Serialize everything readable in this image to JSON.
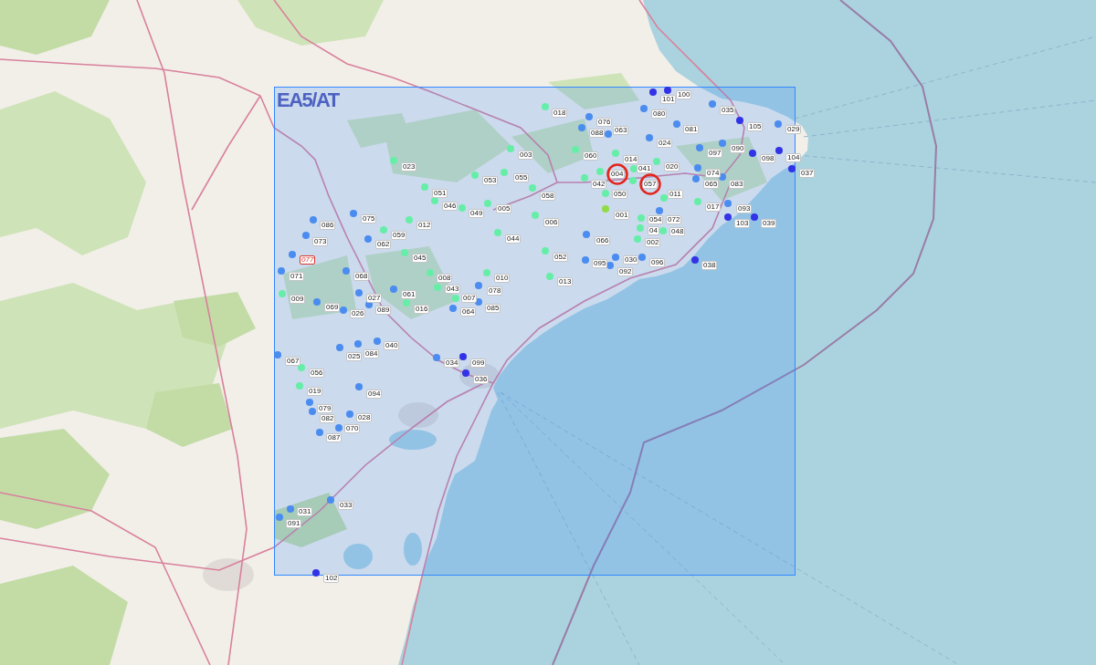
{
  "map": {
    "area_label": "EA5/AT",
    "stations": [
      {
        "label": "101",
        "color": "#3232e6",
        "selected": false,
        "flagged": false
      },
      {
        "label": "100",
        "color": "#3232e6",
        "selected": false,
        "flagged": false
      },
      {
        "label": "018",
        "color": "#66eea8",
        "selected": false,
        "flagged": false
      },
      {
        "label": "080",
        "color": "#4a8cf0",
        "selected": false,
        "flagged": false
      },
      {
        "label": "035",
        "color": "#4a8cf0",
        "selected": false,
        "flagged": false
      },
      {
        "label": "076",
        "color": "#4a8cf0",
        "selected": false,
        "flagged": false
      },
      {
        "label": "105",
        "color": "#3232e6",
        "selected": false,
        "flagged": false
      },
      {
        "label": "088",
        "color": "#4a8cf0",
        "selected": false,
        "flagged": false
      },
      {
        "label": "063",
        "color": "#4a8cf0",
        "selected": false,
        "flagged": false
      },
      {
        "label": "081",
        "color": "#4a8cf0",
        "selected": false,
        "flagged": false
      },
      {
        "label": "029",
        "color": "#4a8cf0",
        "selected": false,
        "flagged": false
      },
      {
        "label": "024",
        "color": "#4a8cf0",
        "selected": false,
        "flagged": false
      },
      {
        "label": "097",
        "color": "#4a8cf0",
        "selected": false,
        "flagged": false
      },
      {
        "label": "090",
        "color": "#4a8cf0",
        "selected": false,
        "flagged": false
      },
      {
        "label": "003",
        "color": "#66eea8",
        "selected": false,
        "flagged": false
      },
      {
        "label": "060",
        "color": "#66eea8",
        "selected": false,
        "flagged": false
      },
      {
        "label": "014",
        "color": "#66eea8",
        "selected": false,
        "flagged": false
      },
      {
        "label": "098",
        "color": "#3232e6",
        "selected": false,
        "flagged": false
      },
      {
        "label": "104",
        "color": "#3232e6",
        "selected": false,
        "flagged": false
      },
      {
        "label": "023",
        "color": "#66eea8",
        "selected": false,
        "flagged": false
      },
      {
        "label": "041",
        "color": "#66eea8",
        "selected": false,
        "flagged": false
      },
      {
        "label": "020",
        "color": "#66eea8",
        "selected": false,
        "flagged": false
      },
      {
        "label": "055",
        "color": "#66eea8",
        "selected": false,
        "flagged": false
      },
      {
        "label": "004",
        "color": "#66eea8",
        "selected": true,
        "flagged": false
      },
      {
        "label": "074",
        "color": "#4a8cf0",
        "selected": false,
        "flagged": false
      },
      {
        "label": "037",
        "color": "#3232e6",
        "selected": false,
        "flagged": false
      },
      {
        "label": "053",
        "color": "#66eea8",
        "selected": false,
        "flagged": false
      },
      {
        "label": "042",
        "color": "#66eea8",
        "selected": false,
        "flagged": false
      },
      {
        "label": "057",
        "color": "#66eea8",
        "selected": true,
        "flagged": false
      },
      {
        "label": "065",
        "color": "#4a8cf0",
        "selected": false,
        "flagged": false
      },
      {
        "label": "083",
        "color": "#4a8cf0",
        "selected": false,
        "flagged": false
      },
      {
        "label": "051",
        "color": "#66eea8",
        "selected": false,
        "flagged": false
      },
      {
        "label": "058",
        "color": "#66eea8",
        "selected": false,
        "flagged": false
      },
      {
        "label": "050",
        "color": "#66eea8",
        "selected": false,
        "flagged": false
      },
      {
        "label": "011",
        "color": "#66eea8",
        "selected": false,
        "flagged": false
      },
      {
        "label": "046",
        "color": "#66eea8",
        "selected": false,
        "flagged": false
      },
      {
        "label": "049",
        "color": "#66eea8",
        "selected": false,
        "flagged": false
      },
      {
        "label": "005",
        "color": "#66eea8",
        "selected": false,
        "flagged": false
      },
      {
        "label": "001",
        "color": "#8fdc48",
        "selected": false,
        "flagged": false
      },
      {
        "label": "017",
        "color": "#66eea8",
        "selected": false,
        "flagged": false
      },
      {
        "label": "093",
        "color": "#4a8cf0",
        "selected": false,
        "flagged": false
      },
      {
        "label": "086",
        "color": "#4a8cf0",
        "selected": false,
        "flagged": false
      },
      {
        "label": "075",
        "color": "#4a8cf0",
        "selected": false,
        "flagged": false
      },
      {
        "label": "012",
        "color": "#66eea8",
        "selected": false,
        "flagged": false
      },
      {
        "label": "006",
        "color": "#66eea8",
        "selected": false,
        "flagged": false
      },
      {
        "label": "054",
        "color": "#66eea8",
        "selected": false,
        "flagged": false
      },
      {
        "label": "072",
        "color": "#4a8cf0",
        "selected": false,
        "flagged": false
      },
      {
        "label": "103",
        "color": "#3232e6",
        "selected": false,
        "flagged": false
      },
      {
        "label": "039",
        "color": "#3232e6",
        "selected": false,
        "flagged": false
      },
      {
        "label": "059",
        "color": "#66eea8",
        "selected": false,
        "flagged": false
      },
      {
        "label": "04",
        "color": "#66eea8",
        "selected": false,
        "flagged": false
      },
      {
        "label": "048",
        "color": "#66eea8",
        "selected": false,
        "flagged": false
      },
      {
        "label": "073",
        "color": "#4a8cf0",
        "selected": false,
        "flagged": false
      },
      {
        "label": "062",
        "color": "#4a8cf0",
        "selected": false,
        "flagged": false
      },
      {
        "label": "044",
        "color": "#66eea8",
        "selected": false,
        "flagged": false
      },
      {
        "label": "066",
        "color": "#4a8cf0",
        "selected": false,
        "flagged": false
      },
      {
        "label": "002",
        "color": "#66eea8",
        "selected": false,
        "flagged": false
      },
      {
        "label": "077",
        "color": "#4a8cf0",
        "selected": false,
        "flagged": true
      },
      {
        "label": "045",
        "color": "#66eea8",
        "selected": false,
        "flagged": false
      },
      {
        "label": "052",
        "color": "#66eea8",
        "selected": false,
        "flagged": false
      },
      {
        "label": "095",
        "color": "#4a8cf0",
        "selected": false,
        "flagged": false
      },
      {
        "label": "030",
        "color": "#4a8cf0",
        "selected": false,
        "flagged": false
      },
      {
        "label": "096",
        "color": "#4a8cf0",
        "selected": false,
        "flagged": false
      },
      {
        "label": "038",
        "color": "#3232e6",
        "selected": false,
        "flagged": false
      },
      {
        "label": "071",
        "color": "#4a8cf0",
        "selected": false,
        "flagged": false
      },
      {
        "label": "068",
        "color": "#4a8cf0",
        "selected": false,
        "flagged": false
      },
      {
        "label": "008",
        "color": "#66eea8",
        "selected": false,
        "flagged": false
      },
      {
        "label": "010",
        "color": "#66eea8",
        "selected": false,
        "flagged": false
      },
      {
        "label": "013",
        "color": "#66eea8",
        "selected": false,
        "flagged": false
      },
      {
        "label": "092",
        "color": "#4a8cf0",
        "selected": false,
        "flagged": false
      },
      {
        "label": "061",
        "color": "#4a8cf0",
        "selected": false,
        "flagged": false
      },
      {
        "label": "043",
        "color": "#66eea8",
        "selected": false,
        "flagged": false
      },
      {
        "label": "078",
        "color": "#4a8cf0",
        "selected": false,
        "flagged": false
      },
      {
        "label": "009",
        "color": "#66eea8",
        "selected": false,
        "flagged": false
      },
      {
        "label": "027",
        "color": "#4a8cf0",
        "selected": false,
        "flagged": false
      },
      {
        "label": "007",
        "color": "#66eea8",
        "selected": false,
        "flagged": false
      },
      {
        "label": "069",
        "color": "#4a8cf0",
        "selected": false,
        "flagged": false
      },
      {
        "label": "026",
        "color": "#4a8cf0",
        "selected": false,
        "flagged": false
      },
      {
        "label": "089",
        "color": "#4a8cf0",
        "selected": false,
        "flagged": false
      },
      {
        "label": "016",
        "color": "#66eea8",
        "selected": false,
        "flagged": false
      },
      {
        "label": "064",
        "color": "#4a8cf0",
        "selected": false,
        "flagged": false
      },
      {
        "label": "085",
        "color": "#4a8cf0",
        "selected": false,
        "flagged": false
      },
      {
        "label": "040",
        "color": "#4a8cf0",
        "selected": false,
        "flagged": false
      },
      {
        "label": "025",
        "color": "#4a8cf0",
        "selected": false,
        "flagged": false
      },
      {
        "label": "084",
        "color": "#4a8cf0",
        "selected": false,
        "flagged": false
      },
      {
        "label": "067",
        "color": "#4a8cf0",
        "selected": false,
        "flagged": false
      },
      {
        "label": "034",
        "color": "#4a8cf0",
        "selected": false,
        "flagged": false
      },
      {
        "label": "099",
        "color": "#3232e6",
        "selected": false,
        "flagged": false
      },
      {
        "label": "056",
        "color": "#66eea8",
        "selected": false,
        "flagged": false
      },
      {
        "label": "036",
        "color": "#3232e6",
        "selected": false,
        "flagged": false
      },
      {
        "label": "019",
        "color": "#66eea8",
        "selected": false,
        "flagged": false
      },
      {
        "label": "094",
        "color": "#4a8cf0",
        "selected": false,
        "flagged": false
      },
      {
        "label": "079",
        "color": "#4a8cf0",
        "selected": false,
        "flagged": false
      },
      {
        "label": "082",
        "color": "#4a8cf0",
        "selected": false,
        "flagged": false
      },
      {
        "label": "028",
        "color": "#4a8cf0",
        "selected": false,
        "flagged": false
      },
      {
        "label": "070",
        "color": "#4a8cf0",
        "selected": false,
        "flagged": false
      },
      {
        "label": "087",
        "color": "#4a8cf0",
        "selected": false,
        "flagged": false
      },
      {
        "label": "033",
        "color": "#4a8cf0",
        "selected": false,
        "flagged": false
      },
      {
        "label": "031",
        "color": "#4a8cf0",
        "selected": false,
        "flagged": false
      },
      {
        "label": "091",
        "color": "#4a8cf0",
        "selected": false,
        "flagged": false
      },
      {
        "label": "102",
        "color": "#3232e6",
        "selected": false,
        "flagged": false
      }
    ]
  }
}
